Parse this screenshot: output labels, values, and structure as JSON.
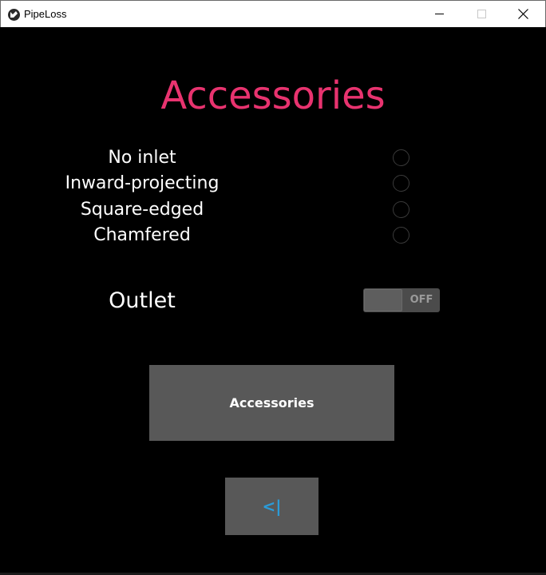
{
  "window": {
    "title": "PipeLoss",
    "icon": "kivy-logo-icon",
    "controls": [
      "minimize-icon",
      "maximize-icon",
      "close-icon"
    ]
  },
  "page": {
    "heading": "Accessories",
    "heading_color": "#e8336f"
  },
  "inlet_options": [
    {
      "label": "No inlet",
      "selected": false
    },
    {
      "label": "Inward-projecting",
      "selected": false
    },
    {
      "label": "Square-edged",
      "selected": false
    },
    {
      "label": "Chamfered",
      "selected": false
    }
  ],
  "outlet": {
    "label": "Outlet",
    "switch_state": "OFF"
  },
  "buttons": {
    "accessories_label": "Accessories",
    "back_label": "<|",
    "back_color": "#2b9bd8"
  }
}
